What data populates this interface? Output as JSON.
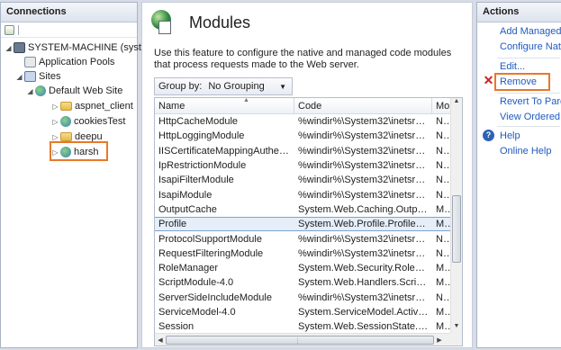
{
  "connections": {
    "title": "Connections",
    "tree": [
      {
        "label": "SYSTEM-MACHINE (syste",
        "icon": "computer-icon"
      },
      {
        "label": "Application Pools",
        "icon": "app-pool-icon"
      },
      {
        "label": "Sites",
        "icon": "sites-icon"
      },
      {
        "label": "Default Web Site",
        "icon": "globe-icon"
      },
      {
        "label": "aspnet_client",
        "icon": "folder-icon"
      },
      {
        "label": "cookiesTest",
        "icon": "globe-icon"
      },
      {
        "label": "deepu",
        "icon": "folder-icon"
      },
      {
        "label": "harsh",
        "icon": "globe-icon"
      }
    ]
  },
  "main": {
    "title": "Modules",
    "description": "Use this feature to configure the native and managed code modules that process requests made to the Web server.",
    "group_by_label": "Group by:",
    "group_by_value": "No Grouping",
    "columns": [
      "Name",
      "Code",
      "Mo"
    ],
    "rows": [
      {
        "name": "HttpCacheModule",
        "code": "%windir%\\System32\\inetsrv\\...",
        "mo": "Nat"
      },
      {
        "name": "HttpLoggingModule",
        "code": "%windir%\\System32\\inetsrv\\...",
        "mo": "Nat"
      },
      {
        "name": "IISCertificateMappingAuthenti...",
        "code": "%windir%\\System32\\inetsrv\\...",
        "mo": "Nat"
      },
      {
        "name": "IpRestrictionModule",
        "code": "%windir%\\System32\\inetsrv\\...",
        "mo": "Nat"
      },
      {
        "name": "IsapiFilterModule",
        "code": "%windir%\\System32\\inetsrv\\f...",
        "mo": "Nat"
      },
      {
        "name": "IsapiModule",
        "code": "%windir%\\System32\\inetsrv\\...",
        "mo": "Nat"
      },
      {
        "name": "OutputCache",
        "code": "System.Web.Caching.Output...",
        "mo": "Mar"
      },
      {
        "name": "Profile",
        "code": "System.Web.Profile.ProfileMo...",
        "mo": "Mar"
      },
      {
        "name": "ProtocolSupportModule",
        "code": "%windir%\\System32\\inetsrv\\...",
        "mo": "Nat"
      },
      {
        "name": "RequestFilteringModule",
        "code": "%windir%\\System32\\inetsrv\\...",
        "mo": "Nat"
      },
      {
        "name": "RoleManager",
        "code": "System.Web.Security.RoleMa...",
        "mo": "Mar"
      },
      {
        "name": "ScriptModule-4.0",
        "code": "System.Web.Handlers.Script...",
        "mo": "Mar"
      },
      {
        "name": "ServerSideIncludeModule",
        "code": "%windir%\\System32\\inetsrv\\...",
        "mo": "Nat"
      },
      {
        "name": "ServiceModel-4.0",
        "code": "System.ServiceModel.Activati...",
        "mo": "Mar"
      },
      {
        "name": "Session",
        "code": "System.Web.SessionState.Ses...",
        "mo": "Mar"
      }
    ]
  },
  "actions": {
    "title": "Actions",
    "add_managed": "Add Managed I",
    "configure_native": "Configure Nati",
    "edit": "Edit...",
    "remove": "Remove",
    "revert": "Revert To Parer",
    "view_ordered": "View Ordered L",
    "help": "Help",
    "online_help": "Online Help"
  },
  "colors": {
    "highlight": "#e8782a",
    "link": "#1f5bbf",
    "selection": "#e6eef9"
  }
}
